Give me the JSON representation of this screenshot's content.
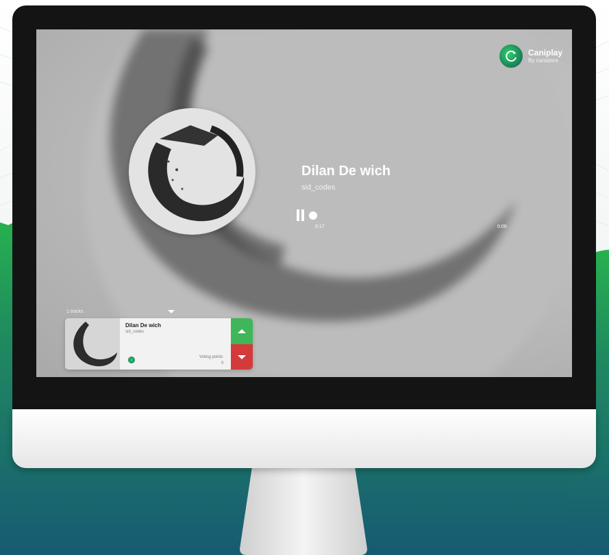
{
  "brand": {
    "name": "Caniplay",
    "subtitle": "By canistore",
    "logo_icon": "refresh-circle-icon"
  },
  "now_playing": {
    "title": "Dilan De wich",
    "artist": "sid_codes",
    "current_time": "0:17",
    "end_time": "0:00"
  },
  "queue": {
    "tracks_label": "1 tracks",
    "items": [
      {
        "title": "Dilan De wich",
        "artist": "sid_codes",
        "voting_points_label": "Voting points",
        "voting_points": "0"
      }
    ]
  },
  "colors": {
    "upvote": "#3fb65a",
    "downvote": "#d43a3a",
    "brand_green": "#2fcf6f",
    "background_teal": "#1a6b72"
  }
}
